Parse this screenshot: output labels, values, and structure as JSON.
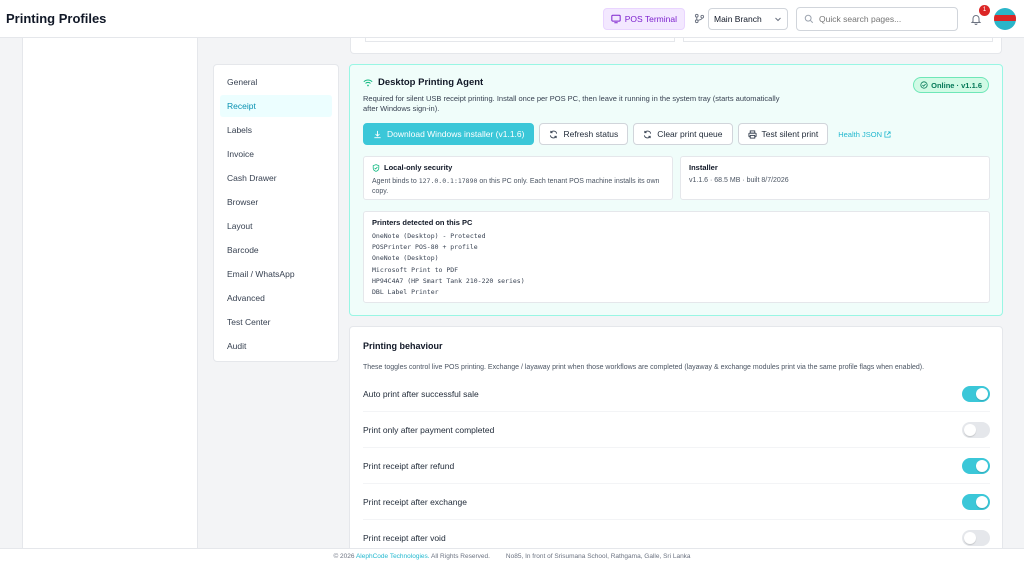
{
  "header": {
    "title": "Printing Profiles",
    "pos_label": "POS Terminal",
    "branch": "Main Branch",
    "search_placeholder": "Quick search pages...",
    "notification_count": "1"
  },
  "tabs": [
    {
      "label": "General"
    },
    {
      "label": "Receipt"
    },
    {
      "label": "Labels"
    },
    {
      "label": "Invoice"
    },
    {
      "label": "Cash Drawer"
    },
    {
      "label": "Browser"
    },
    {
      "label": "Layout"
    },
    {
      "label": "Barcode"
    },
    {
      "label": "Email / WhatsApp"
    },
    {
      "label": "Advanced"
    },
    {
      "label": "Test Center"
    },
    {
      "label": "Audit"
    }
  ],
  "agent": {
    "title": "Desktop Printing Agent",
    "status": "Online · v1.1.6",
    "description": "Required for silent USB receipt printing. Install once per POS PC, then leave it running in the system tray (starts automatically after Windows sign-in).",
    "download_label": "Download Windows installer (v1.1.6)",
    "refresh_label": "Refresh status",
    "clear_queue_label": "Clear print queue",
    "test_label": "Test silent print",
    "health_label": "Health JSON",
    "security_title": "Local-only security",
    "security_text_1": "Agent binds to",
    "security_address": "127.0.0.1:17890",
    "security_text_2": "on this PC only. Each tenant POS machine installs its own copy.",
    "installer_title": "Installer",
    "installer_text": "v1.1.6 · 68.5 MB · built 8/7/2026",
    "printers_title": "Printers detected on this PC",
    "printers": [
      "OneNote (Desktop) - Protected",
      "POSPrinter POS-80 + profile",
      "OneNote (Desktop)",
      "Microsoft Print to PDF",
      "HP94C4A7 (HP Smart Tank 210-220 series)",
      "DBL Label Printer"
    ]
  },
  "behaviour": {
    "title": "Printing behaviour",
    "description": "These toggles control live POS printing. Exchange / layaway print when those workflows are completed (layaway & exchange modules print via the same profile flags when enabled).",
    "toggles": [
      {
        "label": "Auto print after successful sale",
        "on": true
      },
      {
        "label": "Print only after payment completed",
        "on": false
      },
      {
        "label": "Print receipt after refund",
        "on": true
      },
      {
        "label": "Print receipt after exchange",
        "on": true
      },
      {
        "label": "Print receipt after void",
        "on": false
      }
    ]
  },
  "footer": {
    "copyright_prefix": "© 2026",
    "company": "AlephCode Technologies.",
    "rights": "All Rights Reserved.",
    "address": "No85, In front of Srisumana School, Rathgama, Galle, Sri Lanka"
  },
  "colors": {
    "accent": "#3bc7d8",
    "online_green": "#047857",
    "pos_purple": "#7e22ce"
  }
}
